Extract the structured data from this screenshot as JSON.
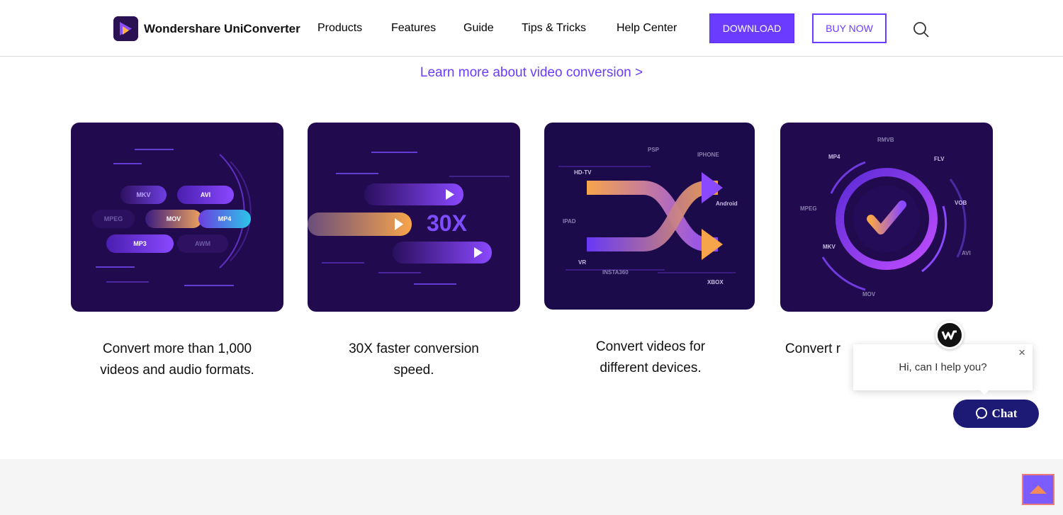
{
  "header": {
    "brand": "Wondershare UniConverter",
    "nav": [
      "Products",
      "Features",
      "Guide",
      "Tips & Tricks",
      "Help Center"
    ],
    "download_label": "DOWNLOAD",
    "buy_label": "BUY NOW",
    "search_icon": "search-icon"
  },
  "learn_more": "Learn more about video conversion >",
  "cards": [
    {
      "caption_line1": "Convert more than 1,000",
      "caption_line2": "videos and audio formats.",
      "pills": [
        "MKV",
        "AVI",
        "MPEG",
        "MOV",
        "MP4",
        "MP3",
        "AWM"
      ]
    },
    {
      "caption_line1": "30X faster conversion",
      "caption_line2": "speed.",
      "speed": "30X"
    },
    {
      "caption_line1": "Convert videos for",
      "caption_line2": "different devices.",
      "devices": [
        "HD-TV",
        "PSP",
        "IPHONE",
        "Android",
        "IPAD",
        "VR",
        "INSTA360",
        "XBOX"
      ]
    },
    {
      "caption_line1": "Convert r",
      "formats": [
        "RMVB",
        "MP4",
        "FLV",
        "MPEG",
        "VOB",
        "MKV",
        "AVI",
        "MOV"
      ]
    }
  ],
  "chat": {
    "greeting": "Hi, can I help you?",
    "close": "×",
    "button_label": "Chat"
  },
  "colors": {
    "accent": "#6b3bff",
    "card_bg": "#220a4e",
    "chat_button": "#1c1a75"
  }
}
